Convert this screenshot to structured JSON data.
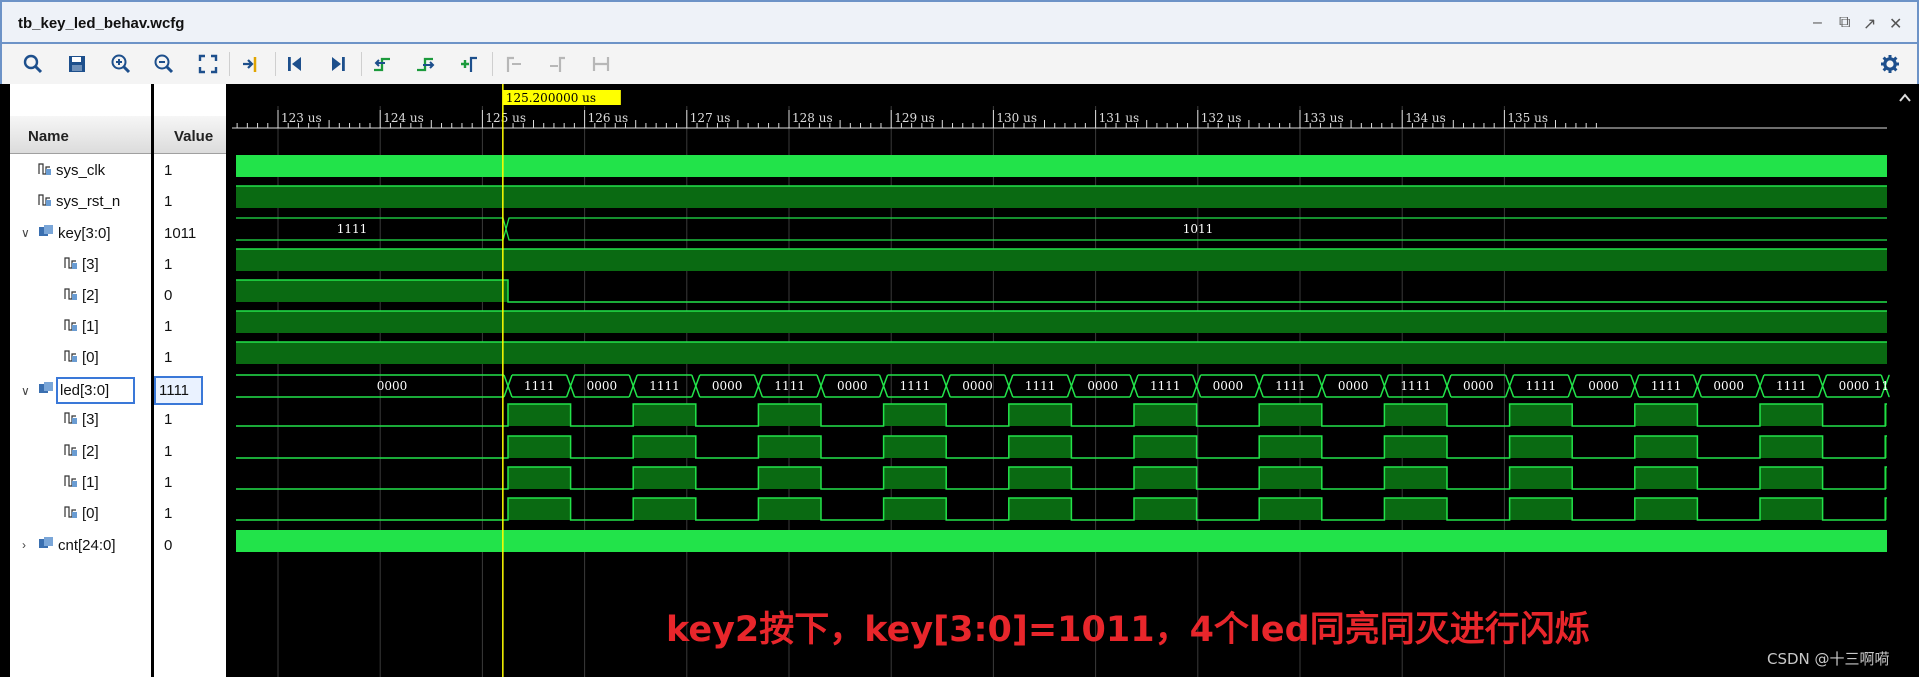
{
  "window": {
    "title": "tb_key_led_behav.wcfg"
  },
  "columns": {
    "name": "Name",
    "value": "Value"
  },
  "cursor": {
    "label": "125.200000 us",
    "time_us": 125.2
  },
  "timeline": {
    "ticks": [
      "123 us",
      "124 us",
      "125 us",
      "126 us",
      "127 us",
      "128 us",
      "129 us",
      "130 us",
      "131 us",
      "132 us",
      "133 us",
      "134 us",
      "135 us"
    ]
  },
  "signals": [
    {
      "name": "sys_clk",
      "value": "1"
    },
    {
      "name": "sys_rst_n",
      "value": "1"
    },
    {
      "name": "key[3:0]",
      "value": "1011",
      "bus_labels": [
        "1111",
        "1011"
      ]
    },
    {
      "name": "[3]",
      "value": "1"
    },
    {
      "name": "[2]",
      "value": "0"
    },
    {
      "name": "[1]",
      "value": "1"
    },
    {
      "name": "[0]",
      "value": "1"
    },
    {
      "name": "led[3:0]",
      "value": "1111",
      "bus_labels": [
        "0000",
        "1111",
        "0000"
      ]
    },
    {
      "name": "[3]",
      "value": "1"
    },
    {
      "name": "[2]",
      "value": "1"
    },
    {
      "name": "[1]",
      "value": "1"
    },
    {
      "name": "[0]",
      "value": "1"
    },
    {
      "name": "cnt[24:0]",
      "value": "0"
    }
  ],
  "caption": "key2按下，key[3:0]=1011，4个led同亮同灭进行闪烁",
  "watermark": "CSDN @十三啊嗬",
  "icons": [
    "search-icon",
    "save-icon",
    "zoom-in-icon",
    "zoom-out-icon",
    "zoom-fit-icon",
    "go-to-cursor-icon",
    "go-to-start-icon",
    "go-to-end-icon",
    "previous-transition-icon",
    "next-transition-icon",
    "add-marker-icon",
    "previous-marker-icon",
    "next-marker-icon",
    "swap-cursors-icon",
    "settings-icon"
  ],
  "colors": {
    "wave": "#22e34a",
    "wave_fill": "#0a6a12",
    "cursor": "#ffff00",
    "caption": "#e8262b"
  }
}
